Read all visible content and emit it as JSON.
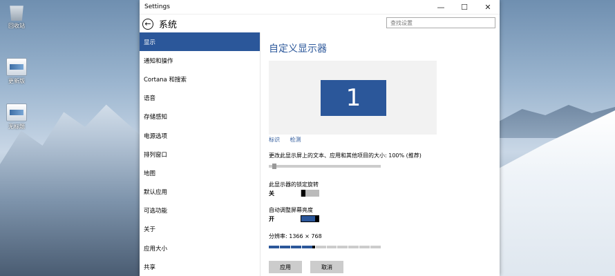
{
  "desktop": {
    "icons": [
      {
        "label": "回收站",
        "type": "recycle"
      },
      {
        "label": "更新版",
        "type": "image"
      },
      {
        "label": "无标题",
        "type": "image"
      }
    ]
  },
  "window": {
    "title": "Settings",
    "controls": {
      "minimize": "—",
      "maximize": "☐",
      "close": "✕"
    }
  },
  "header": {
    "back_icon": "←",
    "heading": "系统",
    "search_placeholder": "查找设置"
  },
  "nav": {
    "items": [
      {
        "label": "显示",
        "active": true
      },
      {
        "label": "通知和操作"
      },
      {
        "label": "Cortana 和搜索"
      },
      {
        "label": "语音"
      },
      {
        "label": "存储感知"
      },
      {
        "label": "电源选项"
      },
      {
        "label": "排列窗口"
      },
      {
        "label": "地图"
      },
      {
        "label": "默认应用"
      },
      {
        "label": "可选功能"
      },
      {
        "label": "关于"
      },
      {
        "label": "应用大小"
      },
      {
        "label": "共享"
      }
    ]
  },
  "content": {
    "title": "自定义显示器",
    "monitor_number": "1",
    "links": {
      "identify": "标识",
      "detect": "检测"
    },
    "scale": {
      "label": "更改此显示屏上的文本、应用和其他项目的大小: 100% (推荐)",
      "value": 0.03
    },
    "rotation_lock": {
      "label": "此显示器的锁定旋转",
      "state": "关"
    },
    "auto_brightness": {
      "label": "自动调整屏幕亮度",
      "state": "开"
    },
    "resolution": {
      "label": "分辨率: 1366 × 768",
      "segments": 10,
      "filled": 4
    },
    "buttons": {
      "apply": "应用",
      "cancel": "取消"
    }
  },
  "colors": {
    "accent": "#2b579a"
  }
}
